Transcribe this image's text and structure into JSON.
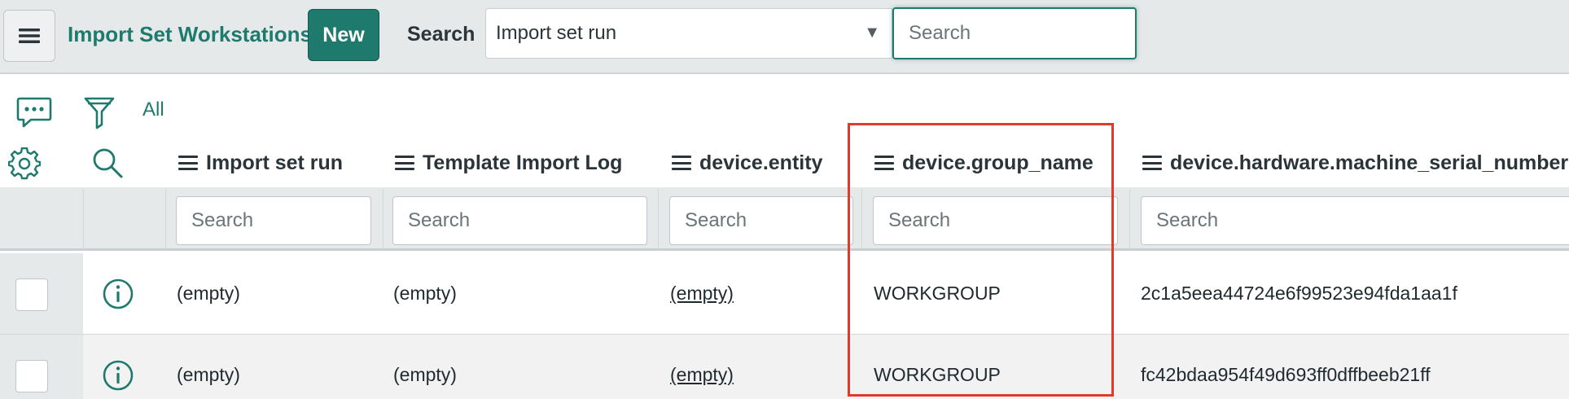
{
  "header": {
    "title": "Import Set Workstations",
    "new_label": "New",
    "search_label": "Search",
    "search_field": "Import set run",
    "search_placeholder": "Search"
  },
  "toolbar": {
    "all_label": "All"
  },
  "columns": [
    {
      "label": "Import set run",
      "search_placeholder": "Search"
    },
    {
      "label": "Template Import Log",
      "search_placeholder": "Search"
    },
    {
      "label": "device.entity",
      "search_placeholder": "Search"
    },
    {
      "label": "device.group_name",
      "search_placeholder": "Search"
    },
    {
      "label": "device.hardware.machine_serial_number",
      "search_placeholder": "Search"
    }
  ],
  "rows": [
    {
      "import_set_run": "(empty)",
      "template_import_log": "(empty)",
      "device_entity": "(empty)",
      "device_group_name": "WORKGROUP",
      "machine_serial_number": "2c1a5eea44724e6f99523e94fda1aa1f"
    },
    {
      "import_set_run": "(empty)",
      "template_import_log": "(empty)",
      "device_entity": "(empty)",
      "device_group_name": "WORKGROUP",
      "machine_serial_number": "fc42bdaa954f49d693ff0dffbeeb21ff"
    }
  ],
  "colors": {
    "accent": "#1f7a6e",
    "header_bg": "#e6e9ea",
    "highlight": "#e03a2b",
    "alt_row_bg": "#f2f2f2"
  },
  "icons": [
    "hamburger-icon",
    "chat-icon",
    "filter-icon",
    "gear-icon",
    "search-icon",
    "info-icon",
    "caret-down-icon"
  ]
}
